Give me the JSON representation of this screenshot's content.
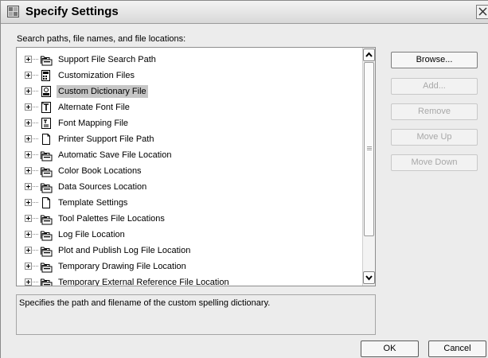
{
  "window": {
    "title": "Specify Settings"
  },
  "main": {
    "label": "Search paths, file names, and file locations:"
  },
  "tree": {
    "items": [
      {
        "label": "Support File Search Path",
        "icon": "folder-stack-icon",
        "selected": false
      },
      {
        "label": "Customization Files",
        "icon": "customization-file-icon",
        "selected": false
      },
      {
        "label": "Custom Dictionary File",
        "icon": "dictionary-file-icon",
        "selected": true
      },
      {
        "label": "Alternate Font File",
        "icon": "font-file-icon",
        "selected": false
      },
      {
        "label": "Font Mapping File",
        "icon": "font-mapping-file-icon",
        "selected": false
      },
      {
        "label": "Printer Support File Path",
        "icon": "document-icon",
        "selected": false
      },
      {
        "label": "Automatic Save File Location",
        "icon": "folder-stack-icon",
        "selected": false
      },
      {
        "label": "Color Book Locations",
        "icon": "folder-stack-icon",
        "selected": false
      },
      {
        "label": "Data Sources Location",
        "icon": "folder-stack-icon",
        "selected": false
      },
      {
        "label": "Template Settings",
        "icon": "document-icon",
        "selected": false
      },
      {
        "label": "Tool Palettes File Locations",
        "icon": "folder-stack-icon",
        "selected": false
      },
      {
        "label": "Log File Location",
        "icon": "folder-stack-icon",
        "selected": false
      },
      {
        "label": "Plot and Publish Log File Location",
        "icon": "folder-stack-icon",
        "selected": false
      },
      {
        "label": "Temporary Drawing File Location",
        "icon": "folder-stack-icon",
        "selected": false
      },
      {
        "label": "Temporary External Reference File Location",
        "icon": "folder-stack-icon",
        "selected": false
      }
    ]
  },
  "description": "Specifies the path and filename of the custom spelling dictionary.",
  "buttons": {
    "browse": "Browse...",
    "add": "Add...",
    "remove": "Remove",
    "move_up": "Move Up",
    "move_down": "Move Down",
    "ok": "OK",
    "cancel": "Cancel"
  },
  "colors": {
    "selection": "#c6c6c6",
    "disabled_text": "#a8a8a8"
  }
}
